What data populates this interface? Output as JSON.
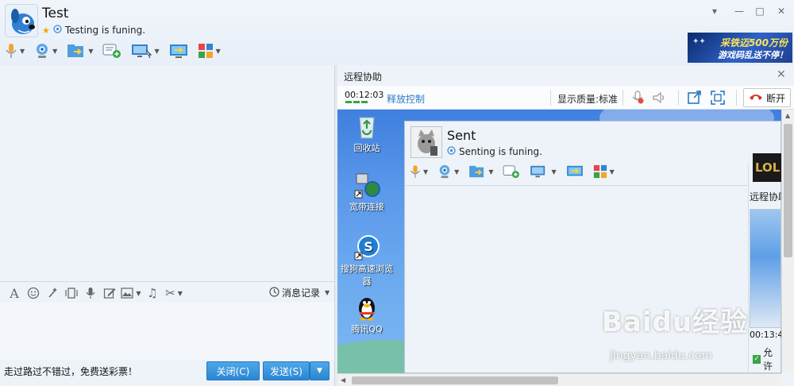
{
  "window": {
    "title": "Test",
    "status": "Testing is funing.",
    "controls": [
      "▾",
      "—",
      "□",
      "✕"
    ]
  },
  "toolbar_icons": [
    "microphone-icon",
    "video-camera-icon",
    "file-transfer-icon",
    "add-chat-icon",
    "screen-share-icon",
    "remote-assist-icon",
    "apps-icon"
  ],
  "ad": {
    "line1": "采铁迈500万份",
    "line2": "游戏码乱送不停！"
  },
  "chat": {
    "format_icons": [
      "font-icon",
      "emoji-icon",
      "magic-wand-icon",
      "shake-window-icon",
      "voice-message-icon",
      "edit-icon",
      "image-icon",
      "music-icon",
      "scissors-icon"
    ],
    "history_label": "消息记录",
    "promo_text": "走过路过不错过，免费送彩票！",
    "close_button": "关闭(C)",
    "send_button": "发送(S)"
  },
  "remote": {
    "title": "远程协助",
    "timer": "00:12:03",
    "release_label": "释放控制",
    "quality_label": "显示质量:标准",
    "disconnect_label": "断开"
  },
  "desktop": {
    "icons": [
      {
        "label": "回收站",
        "icon": "recycle-bin-icon"
      },
      {
        "label": "宽带连接",
        "icon": "broadband-icon"
      },
      {
        "label": "搜狗高速浏览器",
        "icon": "sogou-browser-icon"
      },
      {
        "label": "腾讯QQ",
        "icon": "qq-penguin-icon"
      }
    ]
  },
  "inner_window": {
    "title": "Sent",
    "status": "Senting is funing.",
    "remote_title": "远程协助",
    "timer": "00:13:4",
    "allow_label": "允许",
    "ad_text": "LOL"
  },
  "watermark": {
    "brand": "Baidu经验",
    "url": "jingyan.baidu.com"
  },
  "colors": {
    "accent": "#2b86d3",
    "timer_green": "#3aa345",
    "link_blue": "#2f7bc5"
  }
}
